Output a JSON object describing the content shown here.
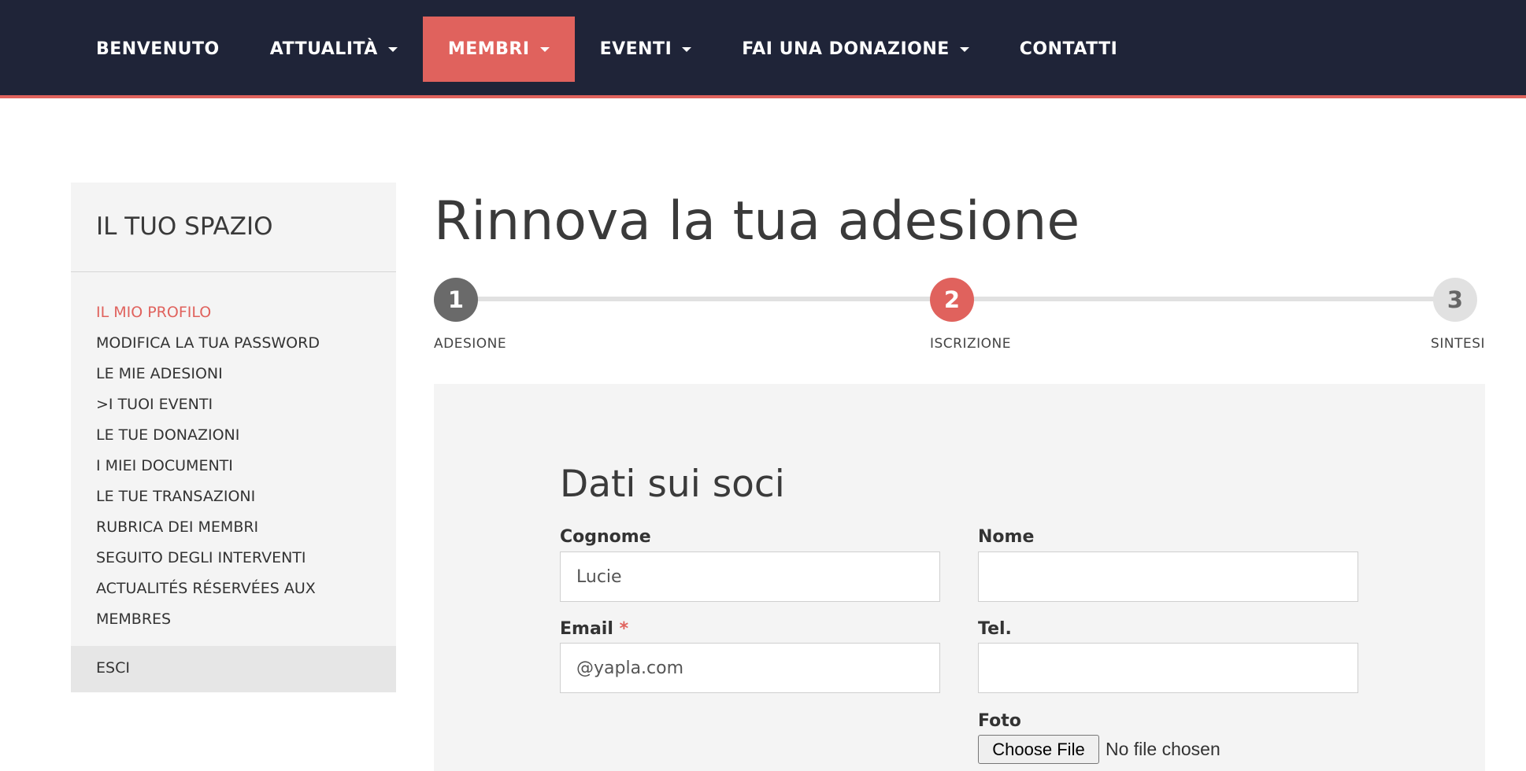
{
  "nav": {
    "items": [
      {
        "label": "BENVENUTO",
        "dropdown": false,
        "active": false
      },
      {
        "label": "ATTUALITÀ",
        "dropdown": true,
        "active": false
      },
      {
        "label": "MEMBRI",
        "dropdown": true,
        "active": true
      },
      {
        "label": "EVENTI",
        "dropdown": true,
        "active": false
      },
      {
        "label": "FAI UNA DONAZIONE",
        "dropdown": true,
        "active": false
      },
      {
        "label": "CONTATTI",
        "dropdown": false,
        "active": false
      }
    ]
  },
  "sidebar": {
    "title": "IL TUO SPAZIO",
    "items": [
      {
        "label": "IL MIO PROFILO",
        "active": true
      },
      {
        "label": "MODIFICA LA TUA PASSWORD"
      },
      {
        "label": "LE MIE ADESIONI"
      },
      {
        "label": ">I TUOI EVENTI"
      },
      {
        "label": "LE TUE DONAZIONI"
      },
      {
        "label": "I MIEI DOCUMENTI"
      },
      {
        "label": "LE TUE TRANSAZIONI"
      },
      {
        "label": "RUBRICA DEI MEMBRI"
      },
      {
        "label": "SEGUITO DEGLI INTERVENTI"
      },
      {
        "label": "ACTUALITÉS RÉSERVÉES AUX"
      },
      {
        "label": "MEMBRES"
      }
    ],
    "logout_label": "ESCI"
  },
  "main": {
    "title": "Rinnova la tua adesione",
    "steps": [
      {
        "number": "1",
        "label": "ADESIONE",
        "state": "completed"
      },
      {
        "number": "2",
        "label": "ISCRIZIONE",
        "state": "current"
      },
      {
        "number": "3",
        "label": "SINTESI",
        "state": "upcoming"
      }
    ],
    "form": {
      "section_title": "Dati sui soci",
      "surname": {
        "label": "Cognome",
        "value": "Lucie"
      },
      "name": {
        "label": "Nome",
        "value": ""
      },
      "email": {
        "label": "Email",
        "required_marker": "*",
        "value": "@yapla.com"
      },
      "phone": {
        "label": "Tel.",
        "value": ""
      },
      "photo": {
        "label": "Foto",
        "button_label": "Choose File",
        "status": "No file chosen"
      }
    }
  },
  "colors": {
    "nav_bg": "#1f2438",
    "accent": "#e0625d",
    "panel_bg": "#f4f4f4"
  }
}
